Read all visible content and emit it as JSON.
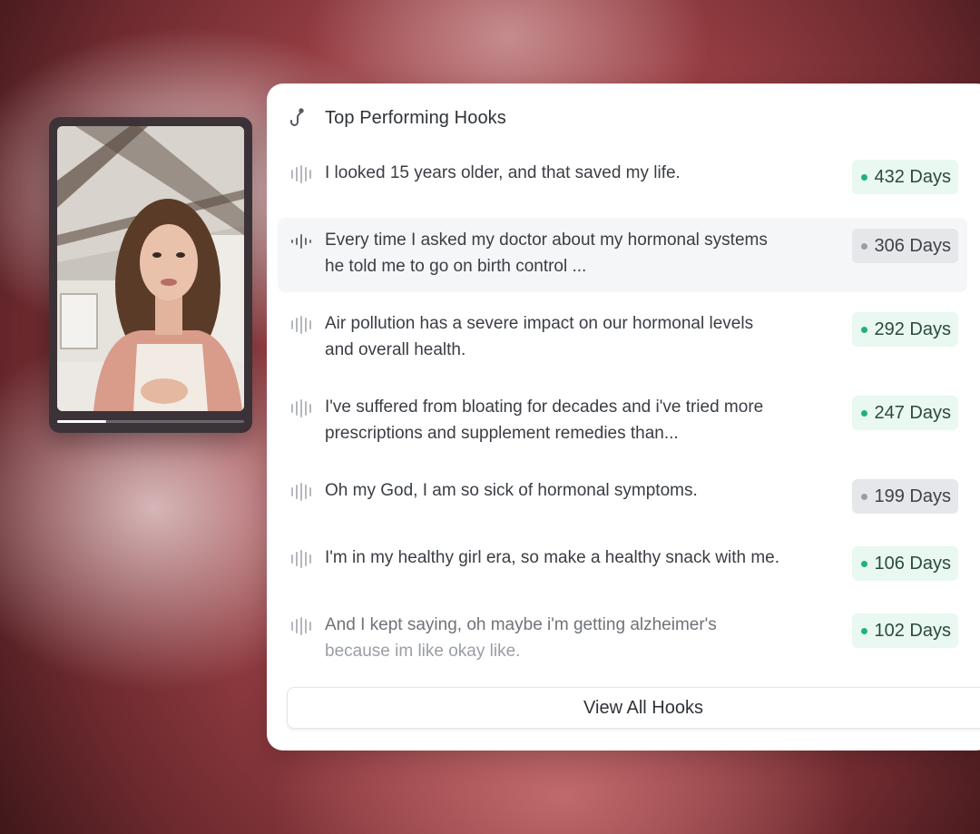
{
  "panel": {
    "title": "Top Performing Hooks",
    "header_icon": "hook-icon",
    "view_all_label": "View All Hooks"
  },
  "video": {
    "progress_fraction": 0.26
  },
  "hooks": [
    {
      "line1": "I looked 15 years older, and that saved my life.",
      "line2": "",
      "days": "432 Days",
      "status": "green"
    },
    {
      "line1": "Every time I asked my doctor about my hormonal systems",
      "line2": "he told me to go on birth control ...",
      "days": "306 Days",
      "status": "gray"
    },
    {
      "line1": "Air pollution has a severe impact on our hormonal levels",
      "line2": "and overall health.",
      "days": "292 Days",
      "status": "green"
    },
    {
      "line1": "I've suffered from bloating for decades and i've tried more",
      "line2": "prescriptions and supplement remedies than...",
      "days": "247 Days",
      "status": "green"
    },
    {
      "line1": "Oh my God, I am so sick of hormonal symptoms.",
      "line2": "",
      "days": "199 Days",
      "status": "gray"
    },
    {
      "line1": "I'm in my healthy girl era, so make a healthy snack with me.",
      "line2": "",
      "days": "106 Days",
      "status": "green"
    },
    {
      "line1": "And I kept saying, oh maybe i'm getting alzheimer's",
      "line2": "because im like okay like.",
      "days": "102 Days",
      "status": "green"
    }
  ],
  "colors": {
    "green_dot": "#20b27a",
    "green_badge_bg": "#e9f8f1",
    "gray_badge_bg": "#e6e7ea"
  }
}
